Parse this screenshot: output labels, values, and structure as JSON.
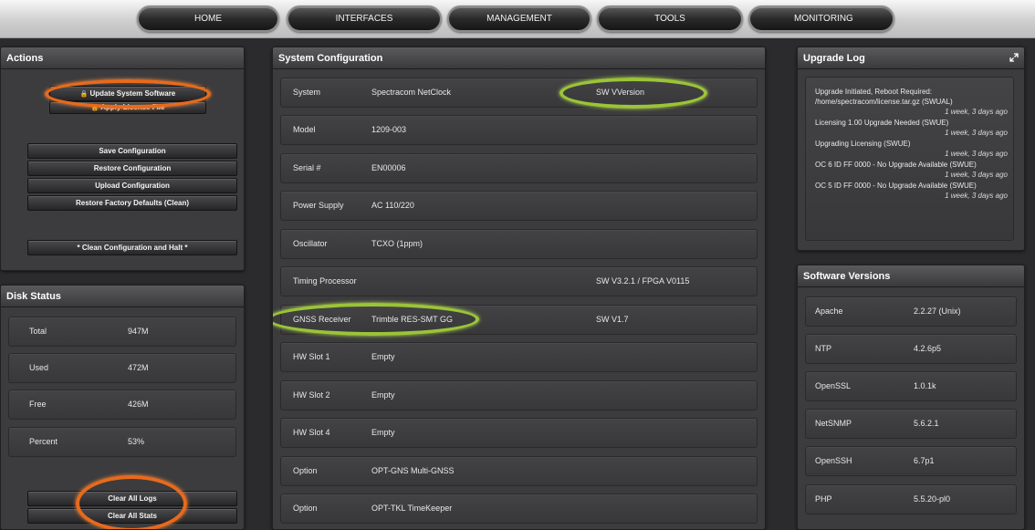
{
  "nav": {
    "items": [
      "HOME",
      "INTERFACES",
      "MANAGEMENT",
      "TOOLS",
      "MONITORING"
    ]
  },
  "actions": {
    "title": "Actions",
    "update_software": "Update System Software",
    "apply_license": "Apply License File",
    "save_config": "Save Configuration",
    "restore_config": "Restore Configuration",
    "upload_config": "Upload Configuration",
    "restore_factory": "Restore Factory Defaults (Clean)",
    "clean_halt": "* Clean Configuration and Halt *"
  },
  "disk": {
    "title": "Disk Status",
    "rows": [
      {
        "label": "Total",
        "value": "947M"
      },
      {
        "label": "Used",
        "value": "472M"
      },
      {
        "label": "Free",
        "value": "426M"
      },
      {
        "label": "Percent",
        "value": "53%"
      }
    ],
    "clear_logs": "Clear All Logs",
    "clear_stats": "Clear All Stats"
  },
  "sysconfig": {
    "title": "System Configuration",
    "rows": [
      {
        "label": "System",
        "value": "Spectracom NetClock",
        "version": "SW VVersion"
      },
      {
        "label": "Model",
        "value": "1209-003",
        "version": ""
      },
      {
        "label": "Serial #",
        "value": "EN00006",
        "version": ""
      },
      {
        "label": "Power Supply",
        "value": "AC 110/220",
        "version": ""
      },
      {
        "label": "Oscillator",
        "value": "TCXO (1ppm)",
        "version": ""
      },
      {
        "label": "Timing Processor",
        "value": "",
        "version": "SW V3.2.1 / FPGA V0115"
      },
      {
        "label": "GNSS Receiver",
        "value": "Trimble RES-SMT GG",
        "version": "SW V1.7"
      },
      {
        "label": "HW Slot 1",
        "value": "Empty",
        "version": ""
      },
      {
        "label": "HW Slot 2",
        "value": "Empty",
        "version": ""
      },
      {
        "label": "HW Slot 4",
        "value": "Empty",
        "version": ""
      },
      {
        "label": "Option",
        "value": "OPT-GNS Multi-GNSS",
        "version": ""
      },
      {
        "label": "Option",
        "value": "OPT-TKL TimeKeeper",
        "version": ""
      }
    ]
  },
  "upgrade": {
    "title": "Upgrade Log",
    "entries": [
      {
        "text": "Upgrade Initiated, Reboot Required: /home/spectracom/license.tar.gz (SWUAL)",
        "ago": "1 week, 3 days ago"
      },
      {
        "text": "Licensing 1.00 Upgrade Needed (SWUE)",
        "ago": "1 week, 3 days ago"
      },
      {
        "text": "Upgrading Licensing (SWUE)",
        "ago": "1 week, 3 days ago"
      },
      {
        "text": "OC 6 ID FF 0000 - No Upgrade Available (SWUE)",
        "ago": "1 week, 3 days ago"
      },
      {
        "text": "OC 5 ID FF 0000 - No Upgrade Available (SWUE)",
        "ago": "1 week, 3 days ago"
      }
    ]
  },
  "software": {
    "title": "Software Versions",
    "rows": [
      {
        "label": "Apache",
        "value": "2.2.27 (Unix)"
      },
      {
        "label": "NTP",
        "value": "4.2.6p5"
      },
      {
        "label": "OpenSSL",
        "value": "1.0.1k"
      },
      {
        "label": "NetSNMP",
        "value": "5.6.2.1"
      },
      {
        "label": "OpenSSH",
        "value": "6.7p1"
      },
      {
        "label": "PHP",
        "value": "5.5.20-pl0"
      }
    ]
  },
  "colors": {
    "highlight_orange": "#e86a1c",
    "highlight_green": "#9bc438"
  }
}
